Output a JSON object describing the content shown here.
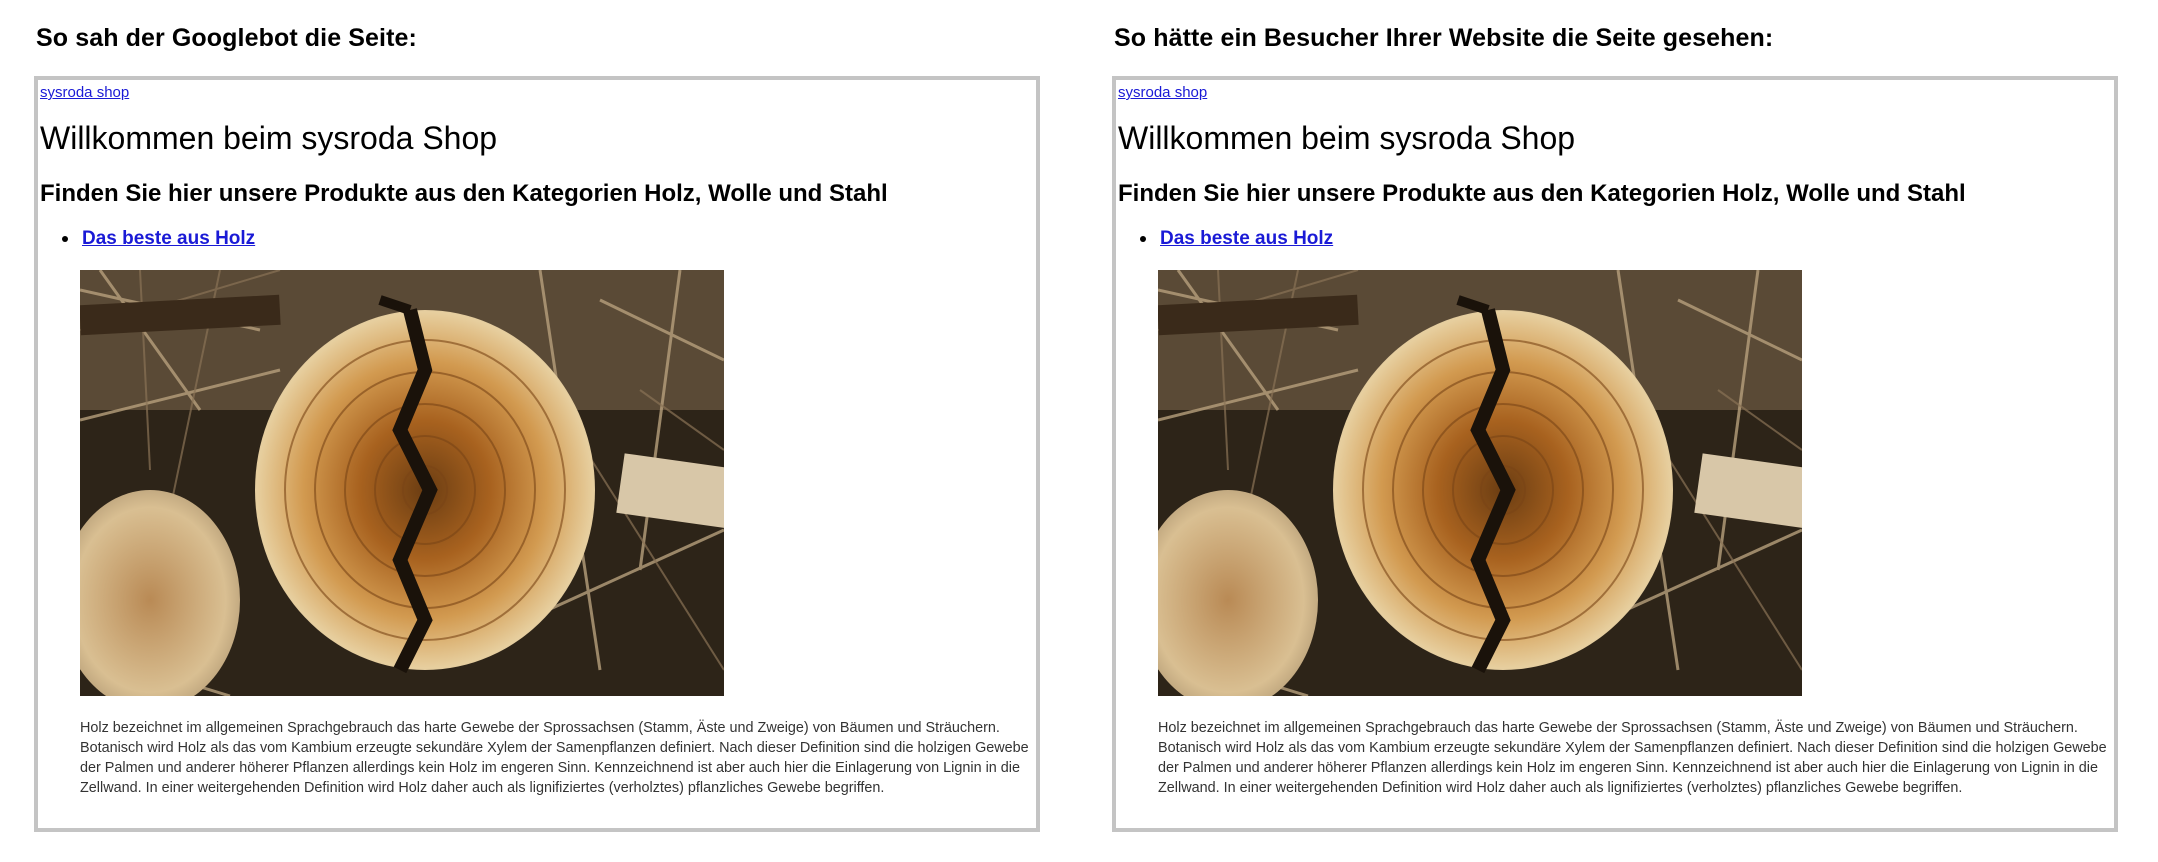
{
  "left": {
    "heading": "So sah der Googlebot die Seite:"
  },
  "right": {
    "heading": "So hätte ein Besucher Ihrer Website die Seite gesehen:"
  },
  "page": {
    "site_link": "sysroda shop",
    "title": "Willkommen beim sysroda Shop",
    "subtitle": "Finden Sie hier unsere Produkte aus den Kategorien Holz, Wolle und Stahl",
    "categories": [
      {
        "label": "Das beste aus Holz"
      }
    ],
    "image_subject": "tree-stump-cross-section",
    "description": "Holz bezeichnet im allgemeinen Sprachgebrauch das harte Gewebe der Sprossachsen (Stamm, Äste und Zweige) von Bäumen und Sträuchern. Botanisch wird Holz als das vom Kambium erzeugte sekundäre Xylem der Samenpflanzen definiert. Nach dieser Definition sind die holzigen Gewebe der Palmen und anderer höherer Pflanzen allerdings kein Holz im engeren Sinn. Kennzeichnend ist aber auch hier die Einlagerung von Lignin in die Zellwand. In einer weitergehenden Definition wird Holz daher auch als lignifiziertes (verholztes) pflanzliches Gewebe begriffen."
  },
  "colors": {
    "link": "#1a1ad6",
    "frame_border": "#c4c4c4",
    "body_text": "#333333"
  }
}
